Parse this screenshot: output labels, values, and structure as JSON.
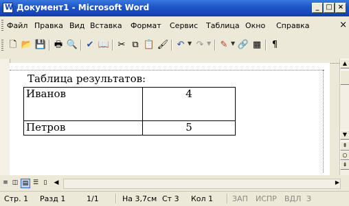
{
  "window": {
    "title": "Документ1 - Microsoft Word",
    "minimize": "_",
    "maximize": "□",
    "close": "×"
  },
  "menu": {
    "items": [
      "Файл",
      "Правка",
      "Вид",
      "Вставка",
      "Формат",
      "Сервис",
      "Таблица",
      "Окно",
      "Справка"
    ],
    "close": "×"
  },
  "toolbar": {
    "icons": [
      "new-document-icon",
      "open-folder-icon",
      "save-icon",
      "print-icon",
      "print-preview-icon",
      "spelling-icon",
      "research-icon",
      "cut-icon",
      "copy-icon",
      "paste-icon",
      "format-painter-icon",
      "undo-icon",
      "redo-icon",
      "drawing-icon",
      "insert-hyperlink-icon",
      "table-icon",
      "show-formatting-icon"
    ],
    "glyphs": {
      "new": "🗋",
      "open": "📂",
      "save": "💾",
      "print": "🖶",
      "preview": "🔍",
      "spell": "✔",
      "research": "📖",
      "cut": "✂",
      "copy": "⧉",
      "paste": "📋",
      "painter": "🖌",
      "undo": "↶",
      "redo": "↷",
      "draw": "✎",
      "hyper": "🔗",
      "table": "▦",
      "pilcrow": "¶"
    }
  },
  "document": {
    "heading": "Таблица результатов:",
    "table": {
      "rows": [
        [
          "Иванов",
          "4"
        ],
        [
          "Петров",
          "5"
        ]
      ]
    }
  },
  "status": {
    "page": "Стр. 1",
    "section": "Разд 1",
    "pages": "1/1",
    "at": "На 3,7см",
    "line": "Ст 3",
    "col": "Кол 1",
    "rec": "ЗАП",
    "trk": "ИСПР",
    "ext": "ВДЛ",
    "ovr": "З"
  }
}
